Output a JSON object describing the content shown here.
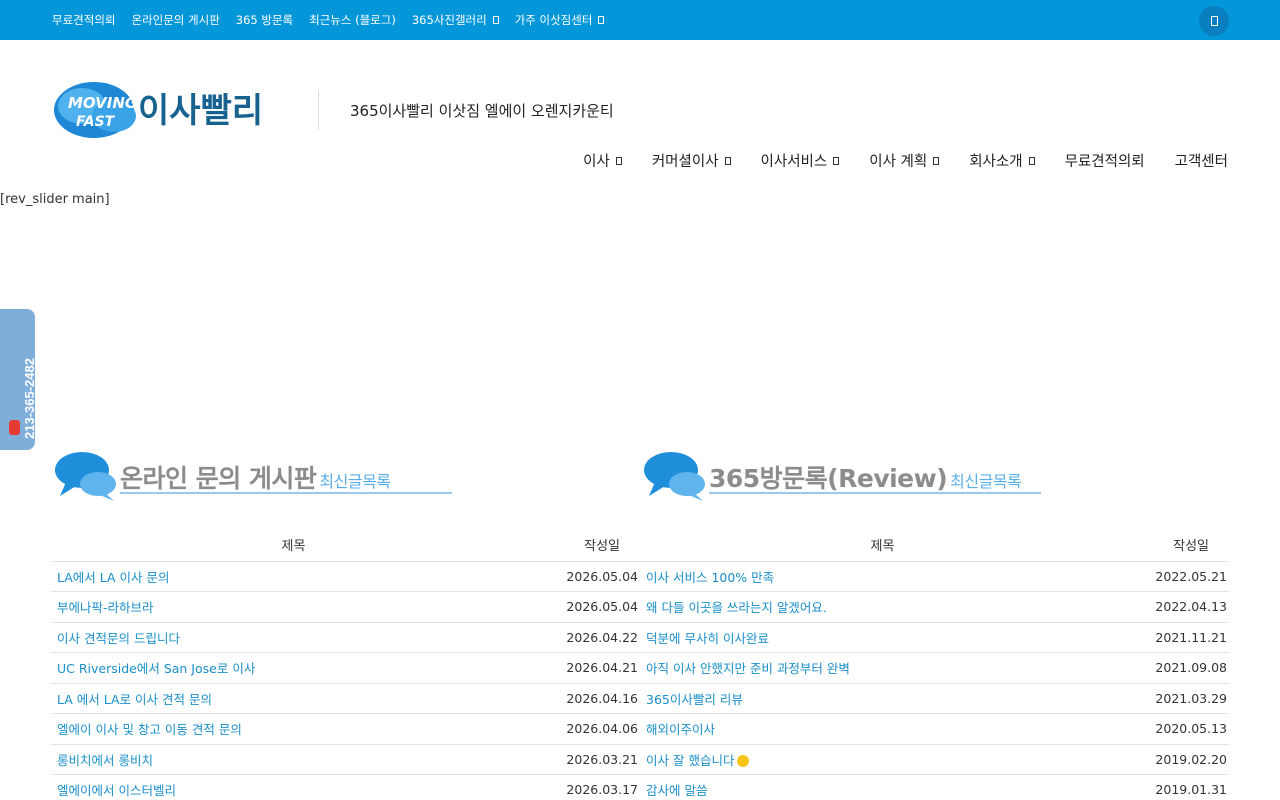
{
  "topbar": {
    "items": [
      {
        "label": "무료견적의뢰",
        "dropdown": false
      },
      {
        "label": "온라인문의 게시판",
        "dropdown": false
      },
      {
        "label": "365 방문록",
        "dropdown": false
      },
      {
        "label": "최근뉴스 (블로그)",
        "dropdown": false
      },
      {
        "label": "365사진갤러리",
        "dropdown": true
      },
      {
        "label": "가주 이삿짐센터",
        "dropdown": true
      }
    ]
  },
  "header": {
    "logo_text_en_1": "MOVING",
    "logo_text_en_2": "FAST",
    "logo_text_ko": "이사빨리",
    "tagline": "365이사빨리 이삿짐 엘에이 오렌지카운티"
  },
  "mainnav": {
    "items": [
      {
        "label": "이사",
        "dropdown": true
      },
      {
        "label": "커머셜이사",
        "dropdown": true
      },
      {
        "label": "이사서비스",
        "dropdown": true
      },
      {
        "label": "이사 계획",
        "dropdown": true
      },
      {
        "label": "회사소개",
        "dropdown": true
      },
      {
        "label": "무료견적의뢰",
        "dropdown": false
      },
      {
        "label": "고객센터",
        "dropdown": false
      }
    ]
  },
  "slider_placeholder": "[rev_slider main]",
  "side_phone": "213-365-2482",
  "boards": {
    "left": {
      "title": "온라인 문의 게시판",
      "sub": "최신글목록",
      "col_title": "제목",
      "col_date": "작성일",
      "rows": [
        {
          "title": "LA에서 LA 이사 문의",
          "date": "2026.05.04"
        },
        {
          "title": "부에나팍-라하브라",
          "date": "2026.05.04"
        },
        {
          "title": "이사 견적문의 드립니다",
          "date": "2026.04.22"
        },
        {
          "title": "UC Riverside에서 San Jose로 이사",
          "date": "2026.04.21"
        },
        {
          "title": "LA 에서 LA로 이사 견적 문의",
          "date": "2026.04.16"
        },
        {
          "title": "엘에이 이사 및 창고 이동 견적 문의",
          "date": "2026.04.06"
        },
        {
          "title": "롱비치에서 롱비치",
          "date": "2026.03.21"
        },
        {
          "title": "엘에이에서 이스터벨리",
          "date": "2026.03.17"
        }
      ]
    },
    "right": {
      "title": "365방문록(Review)",
      "sub": "최신글목록",
      "col_title": "제목",
      "col_date": "작성일",
      "rows": [
        {
          "title": "이사 서비스 100% 만족",
          "date": "2022.05.21"
        },
        {
          "title": "왜 다들 이곳을 쓰라는지 알겠어요.",
          "date": "2022.04.13"
        },
        {
          "title": "덕분에 무사히 이사완료",
          "date": "2021.11.21"
        },
        {
          "title": "아직 이사 안했지만 준비 과정부터 완벽",
          "date": "2021.09.08"
        },
        {
          "title": "365이사빨리 리뷰",
          "date": "2021.03.29"
        },
        {
          "title": "해외이주이사",
          "date": "2020.05.13"
        },
        {
          "title": "이사 잘 했습니다",
          "date": "2019.02.20"
        },
        {
          "title": "감사에 말씀",
          "date": "2019.01.31"
        }
      ]
    }
  }
}
